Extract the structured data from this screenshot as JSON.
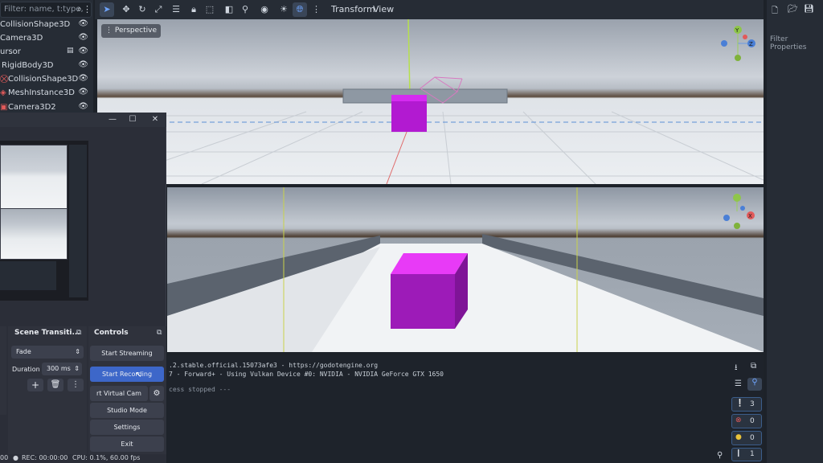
{
  "scene_tree": {
    "filter_placeholder": "Filter: name, t:type,",
    "nodes": [
      {
        "label": "CollisionShape3D"
      },
      {
        "label": "Camera3D"
      },
      {
        "label": "ursor"
      },
      {
        "label": "RigidBody3D"
      },
      {
        "label": "CollisionShape3D"
      },
      {
        "label": "MeshInstance3D"
      },
      {
        "label": "Camera3D2"
      }
    ]
  },
  "toolbar": {
    "transform_menu": "Transform",
    "view_menu": "View"
  },
  "viewport": {
    "perspective_label": "Perspective",
    "gizmo_y": "Y",
    "gizmo_z": "Z",
    "gizmo_x": "X"
  },
  "inspector": {
    "filter_placeholder": "Filter Properties"
  },
  "output": {
    "lines": [
      ".2.stable.official.15073afe3 - https://godotengine.org",
      "7 - Forward+ - Using Vulkan Device #0: NVIDIA - NVIDIA GeForce GTX 1650",
      "",
      "cess stopped ---"
    ],
    "counts": {
      "info": "3",
      "errors": "0",
      "warnings": "0",
      "messages": "1"
    }
  },
  "obs": {
    "transitions_title": "Scene Transiti...",
    "controls_title": "Controls",
    "transition_value": "Fade",
    "duration_label": "Duration",
    "duration_value": "300 ms",
    "buttons": {
      "start_streaming": "Start Streaming",
      "start_recording": "Start Recording",
      "virtual_cam": "rt Virtual Cam",
      "studio_mode": "Studio Mode",
      "settings": "Settings",
      "exit": "Exit"
    },
    "status": {
      "stream": "00",
      "rec": "REC: 00:00:00",
      "cpu": "CPU: 0.1%, 60.00 fps"
    }
  },
  "colors": {
    "cube": "#b21ad1",
    "accent": "#3d67c9",
    "editor_bg": "#262c35"
  }
}
